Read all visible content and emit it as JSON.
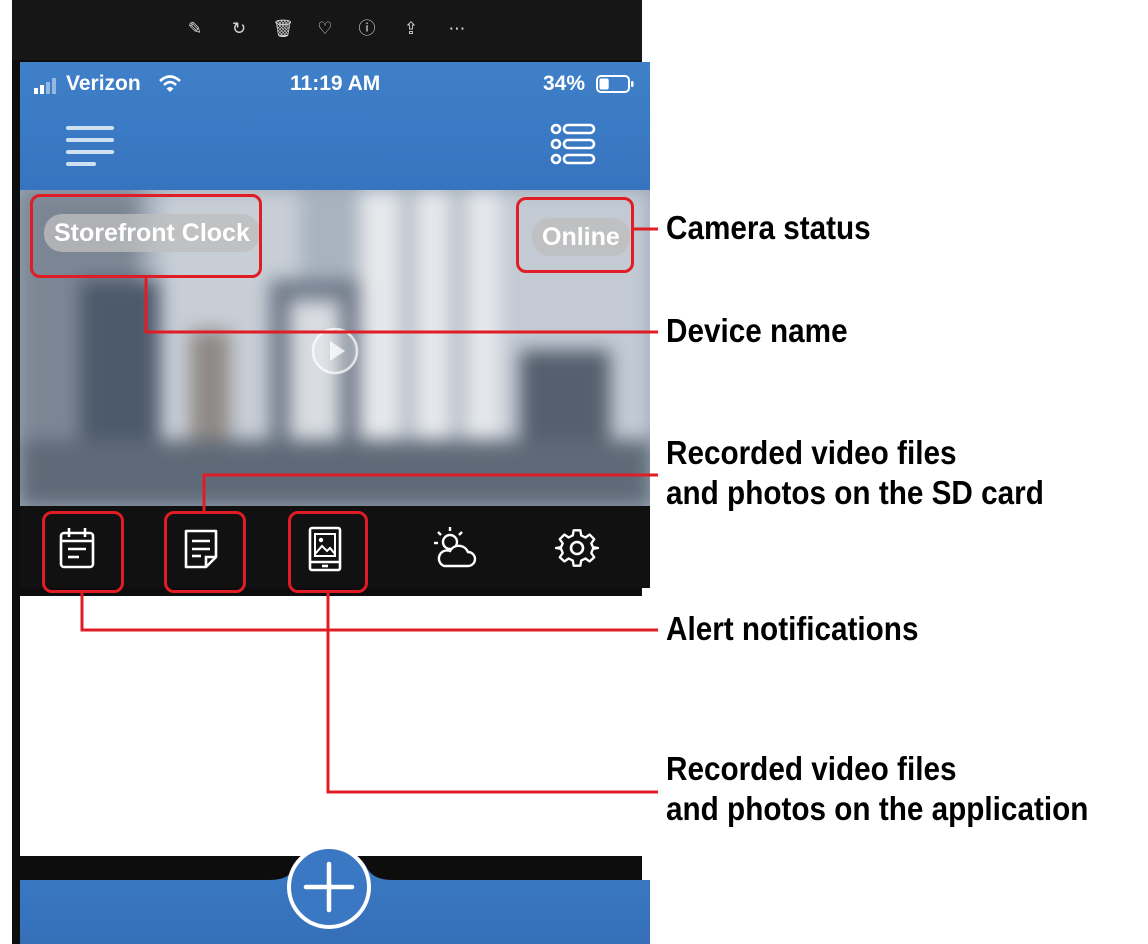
{
  "toolbar": {
    "icons": [
      "edit-icon",
      "rotate-icon",
      "delete-icon",
      "heart-icon",
      "info-icon",
      "share-icon",
      "more-icon"
    ],
    "glyphs": [
      "✎",
      "↻",
      "🗑",
      "♡",
      "ⓘ",
      "⇪",
      "⋯"
    ]
  },
  "status_bar": {
    "carrier": "Verizon",
    "time": "11:19 AM",
    "battery_percent": "34%",
    "battery_level": 0.34
  },
  "camera": {
    "device_name": "Storefront Clock",
    "status": "Online"
  },
  "icon_bar": {
    "icons": [
      "alert-calendar-icon",
      "sd-card-files-icon",
      "app-gallery-icon",
      "weather-icon",
      "settings-gear-icon"
    ]
  },
  "annotations": {
    "camera_status": "Camera status",
    "device_name": "Device name",
    "sd_card_line1": "Recorded video files",
    "sd_card_line2": "and photos on the SD card",
    "alerts": "Alert notifications",
    "app_line1": "Recorded video files",
    "app_line2": "and photos on the application"
  },
  "colors": {
    "header_blue": "#3a78c4",
    "annotation_red": "#e01c24",
    "icon_bar_bg": "#111111"
  }
}
